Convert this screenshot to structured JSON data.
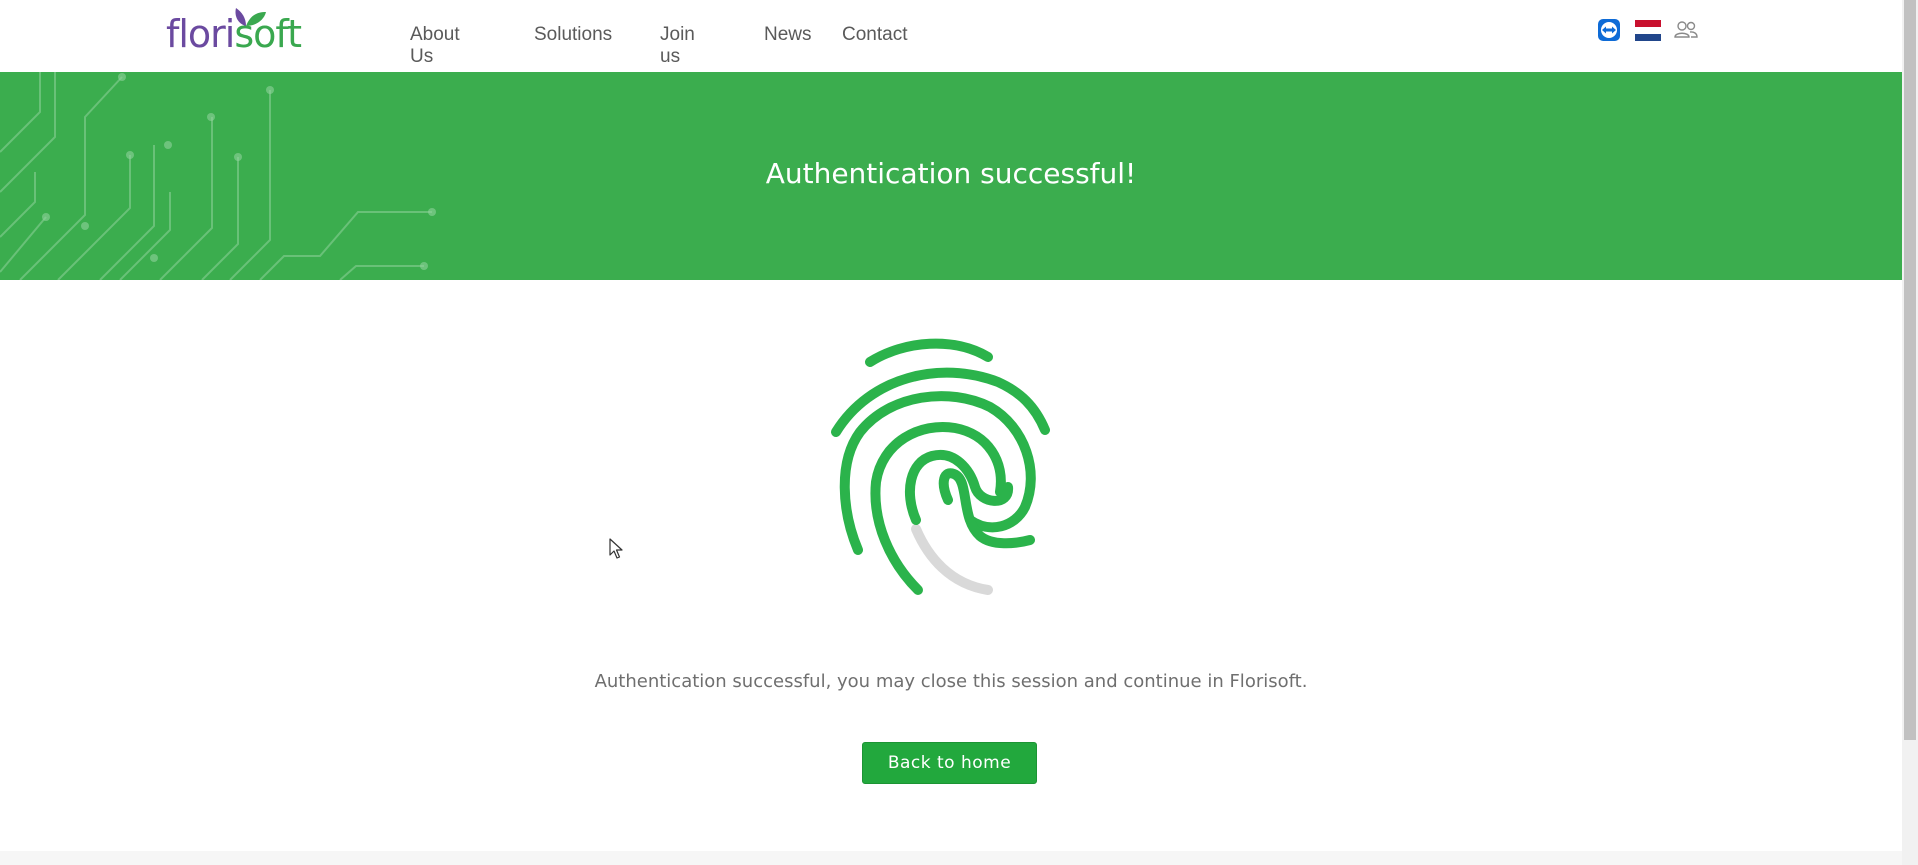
{
  "header": {
    "logo": {
      "part1": "flori",
      "part2": "soft"
    },
    "nav": [
      {
        "label": "About Us"
      },
      {
        "label": "Solutions"
      },
      {
        "label": "Join us"
      },
      {
        "label": "News"
      },
      {
        "label": "Contact"
      }
    ],
    "icons": [
      "teamviewer-icon",
      "dutch-flag-icon",
      "users-icon"
    ]
  },
  "banner": {
    "title": "Authentication successful!",
    "color": "#3bad4e"
  },
  "main": {
    "message": "Authentication successful, you may close this session and continue in Florisoft.",
    "button_label": "Back to home",
    "accent": "#22a83d"
  }
}
